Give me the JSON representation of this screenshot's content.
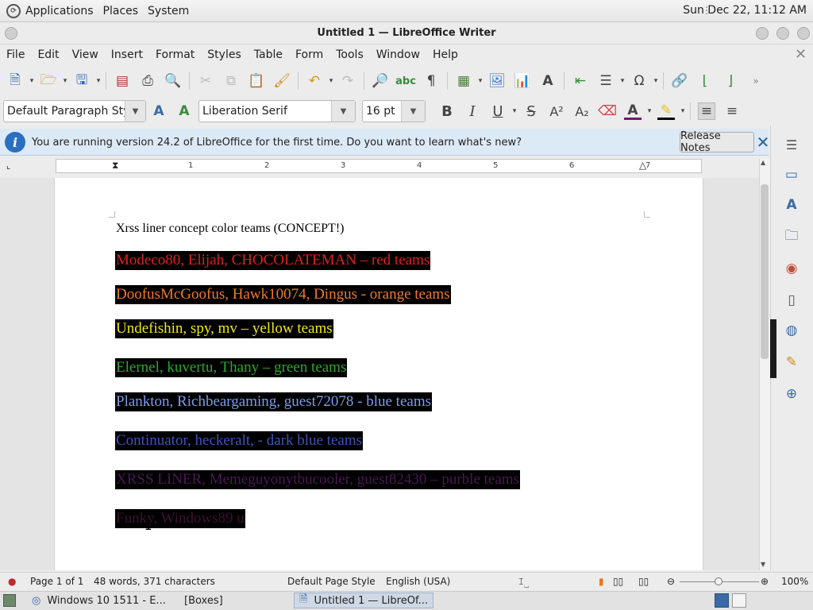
{
  "panel": {
    "menus": [
      "Applications",
      "Places",
      "System"
    ],
    "clock": "Sun Dec 22, 11:12 AM"
  },
  "window": {
    "title": "Untitled 1 — LibreOffice Writer"
  },
  "menubar": [
    "File",
    "Edit",
    "View",
    "Insert",
    "Format",
    "Styles",
    "Table",
    "Form",
    "Tools",
    "Window",
    "Help"
  ],
  "format_toolbar": {
    "paragraph_style": "Default Paragraph Style",
    "font_name": "Liberation Serif",
    "font_size": "16 pt"
  },
  "infobar": {
    "message": "You are running version 24.2 of LibreOffice for the first time. Do you want to learn what's new?",
    "button": "Release Notes"
  },
  "ruler": {
    "numbers": [
      "1",
      "2",
      "3",
      "4",
      "5",
      "6",
      "7"
    ]
  },
  "document": {
    "lines": [
      {
        "text": "Xrss liner concept color teams (CONCEPT!)",
        "color": "#000000",
        "highlight": false
      },
      {
        "text": "Modeco80, Elijah, CHOCOLATEMAN – red teams",
        "color": "#e0201e",
        "highlight": true
      },
      {
        "text": "DoofusMcGoofus, Hawk10074, Dingus - orange teams",
        "color": "#f07a2a",
        "highlight": true
      },
      {
        "text": "Undefishin, spy, mv – yellow teams",
        "color": "#f2e61e",
        "highlight": true
      },
      {
        "text": "Elernel, kuvertu, Thany – green teams",
        "color": "#2fa82c",
        "highlight": true
      },
      {
        "text": "Plankton, Richbeargaming, guest72078 - blue teams",
        "color": "#7b9ee6",
        "highlight": true
      },
      {
        "text": "Continuator, heckeralt, - dark blue teams",
        "color": "#3f54b8",
        "highlight": true
      },
      {
        "text": "XRSS LINER, Memeguyonytbucooler, guest82430 – purble teams",
        "color": "#4a1a55",
        "highlight": true
      },
      {
        "text": "Funky, Windows89 u",
        "color": "#3a1430",
        "highlight": true
      }
    ]
  },
  "statusbar": {
    "page": "Page 1 of 1",
    "words": "48 words, 371 characters",
    "page_style": "Default Page Style",
    "language": "English (USA)",
    "zoom": "100%"
  },
  "taskbar": {
    "items": [
      "Windows 10 1511 - E...",
      "[Boxes]",
      "Untitled 1 — LibreOf..."
    ]
  }
}
